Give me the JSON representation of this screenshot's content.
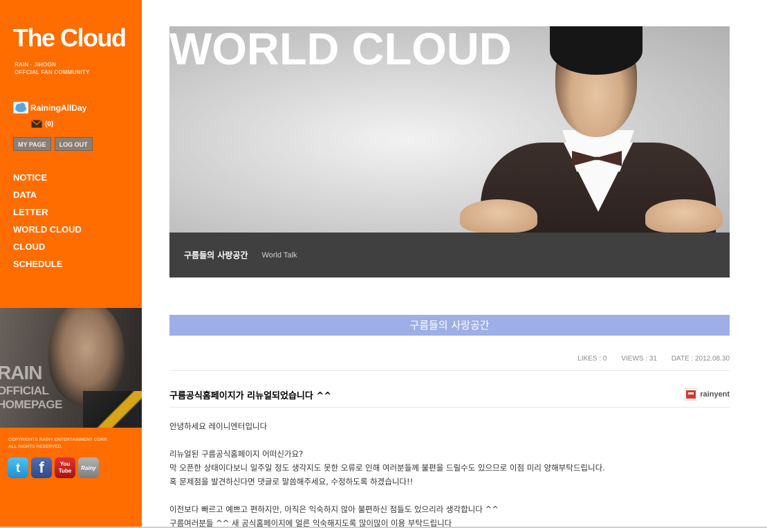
{
  "sidebar": {
    "logo": "The Cloud",
    "tagline": [
      "RAIN · JIHOON",
      "OFFCIAL FAN COMMUNITY"
    ],
    "user": {
      "name": "RainingAllDay",
      "messages": "(0)"
    },
    "buttons": {
      "mypage": "MY PAGE",
      "logout": "LOG OUT"
    },
    "nav": [
      "NOTICE",
      "DATA",
      "LETTER",
      "WORLD CLOUD",
      "CLOUD",
      "SCHEDULE"
    ],
    "promo": {
      "line1": "RAIN",
      "line2": "OFFICIAL",
      "line3": "HOMEPAGE"
    },
    "copyright": [
      "COPYRIGHTS RAINY ENTERTAINMENT CORP.",
      "ALL RIGHTS RESERVED."
    ],
    "social": {
      "twitter": "t",
      "facebook": "f",
      "youtube_a": "You",
      "youtube_b": "Tube",
      "rainy": "Rainy"
    }
  },
  "hero": {
    "title": "WORLD CLOUD",
    "crumb_title": "구름들의 사랑공간",
    "crumb_sub": "World Talk"
  },
  "section": {
    "title": "구름들의 사랑공간"
  },
  "post": {
    "likes": "LIKES : 0",
    "views": "VIEWS : 31",
    "date": "DATE : 2012.08.30",
    "title": "구름공식홈페이지가 리뉴얼되었습니다 ^^",
    "author": "rainyent",
    "lines": [
      "안녕하세요 레이니엔터입니다",
      "",
      "리뉴얼된 구름공식홈페이지 어떠신가요?",
      "막 오픈한 상태이다보니 일주일 정도 생각지도 못한 오류로 인해 여러분들께 불편을 드릴수도 있으므로 이점 미리 양해부탁드립니다.",
      "혹 문제점을 발견하신다면 댓글로 말씀해주세요, 수정하도록 하겠습니다!!",
      "",
      "이전보다 빠르고 예쁘고 편하지만, 아직은 익숙하지 않아 불편하신 점들도 있으리라 생각합니다 ^^",
      "구름여러분들 ^^ 새 공식홈페이지에 얼른 익숙해지도록 많이많이 이용 부탁드립니다"
    ]
  },
  "colors": {
    "sidebar": "#ff6c00",
    "section_bar": "#9eaee6",
    "hero_bar": "#404040"
  }
}
